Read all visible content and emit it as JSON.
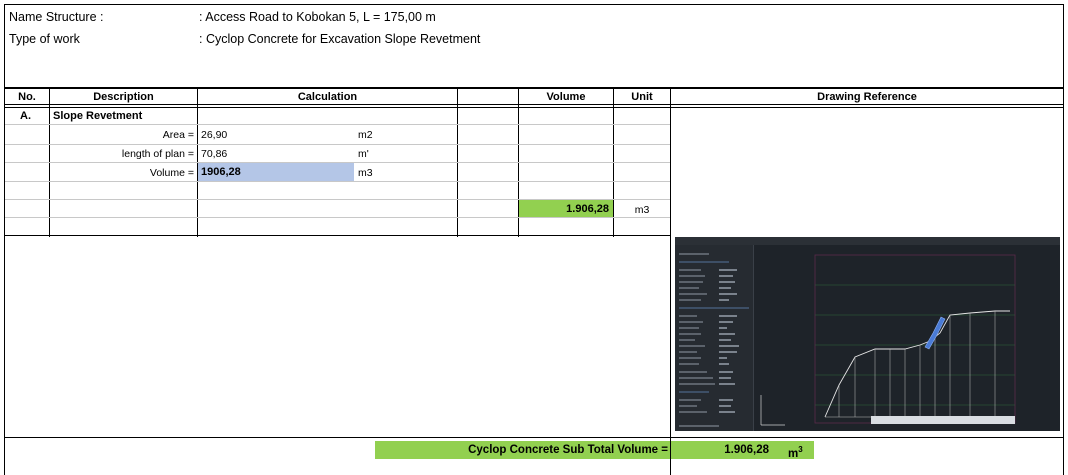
{
  "header": {
    "name_label": "Name Structure :",
    "name_value": ": Access Road to Kobokan 5, L = 175,00 m",
    "type_label": "Type of work",
    "type_value": ": Cyclop Concrete for Excavation Slope Revetment"
  },
  "columns": {
    "no": "No.",
    "description": "Description",
    "calculation": "Calculation",
    "volume": "Volume",
    "unit": "Unit",
    "drawing": "Drawing Reference"
  },
  "section": {
    "no": "A.",
    "title": "Slope Revetment"
  },
  "rows": [
    {
      "label": "Area =",
      "value": "26,90",
      "unit": "m2"
    },
    {
      "label": "length of plan =",
      "value": "70,86",
      "unit": "m'"
    },
    {
      "label": "Volume =",
      "value": "1906,28",
      "unit": "m3"
    }
  ],
  "result": {
    "volume": "1.906,28",
    "unit": "m3"
  },
  "subtotal": {
    "label": "Cyclop Concrete Sub Total Volume =",
    "value": "1.906,28",
    "unit": "m",
    "unit_sup": "3"
  },
  "colors": {
    "green": "#92d050",
    "blue": "#b4c6e7",
    "cad_bg": "#1e2329"
  }
}
